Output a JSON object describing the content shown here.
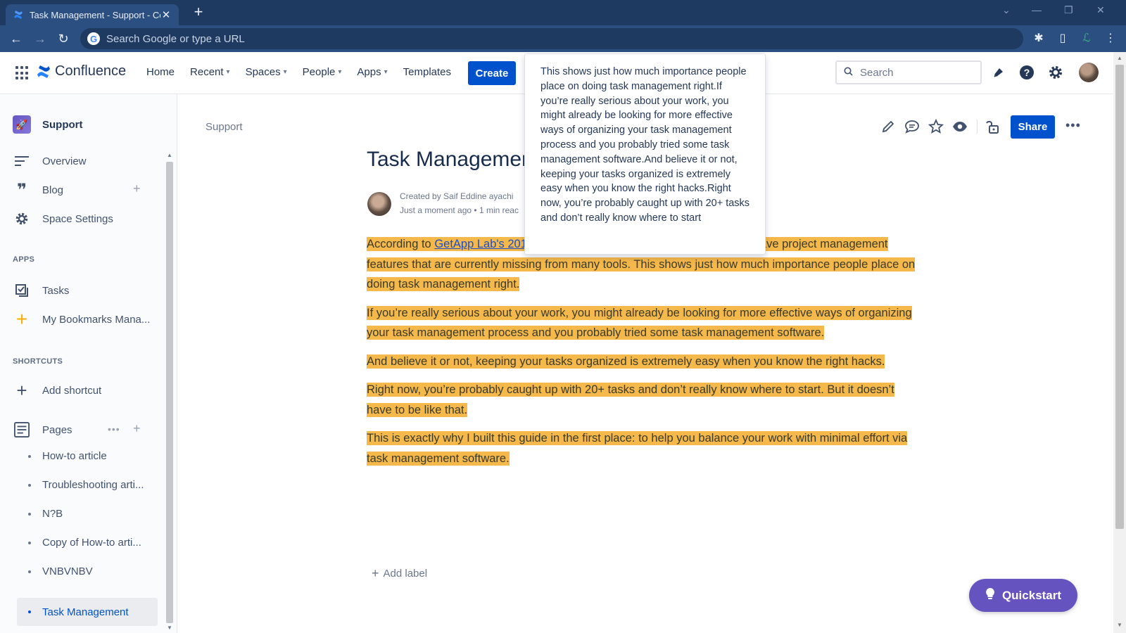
{
  "browser": {
    "tab_title": "Task Management - Support - Co",
    "address_placeholder": "Search Google or type a URL"
  },
  "header": {
    "brand": "Confluence",
    "nav": [
      {
        "label": "Home",
        "dropdown": false
      },
      {
        "label": "Recent",
        "dropdown": true
      },
      {
        "label": "Spaces",
        "dropdown": true
      },
      {
        "label": "People",
        "dropdown": true
      },
      {
        "label": "Apps",
        "dropdown": true
      },
      {
        "label": "Templates",
        "dropdown": false
      }
    ],
    "create_label": "Create",
    "search_placeholder": "Search"
  },
  "sidebar": {
    "space_name": "Support",
    "items": [
      {
        "label": "Overview",
        "icon": "overview-icon"
      },
      {
        "label": "Blog",
        "icon": "quote-icon"
      },
      {
        "label": "Space Settings",
        "icon": "gear-icon"
      }
    ],
    "apps_header": "APPS",
    "apps": [
      {
        "label": "Tasks",
        "icon": "tasks-icon"
      },
      {
        "label": "My Bookmarks Mana...",
        "icon": "plus-icon"
      }
    ],
    "shortcuts_header": "SHORTCUTS",
    "add_shortcut": "Add shortcut",
    "pages_label": "Pages",
    "pages": [
      {
        "label": "How-to article",
        "active": false
      },
      {
        "label": "Troubleshooting arti...",
        "active": false
      },
      {
        "label": "N?B",
        "active": false
      },
      {
        "label": "Copy of How-to arti...",
        "active": false
      },
      {
        "label": "VNBVNBV",
        "active": false
      },
      {
        "label": "Task Management",
        "active": true
      }
    ]
  },
  "page": {
    "breadcrumb": "Support",
    "share_label": "Share",
    "title": "Task Managemen",
    "created_by": "Created by Saif Eddine ayachi",
    "time": "Just a moment ago",
    "read_time": "1 min reac",
    "para1_before": "According to ",
    "para1_link": "GetApp Lab's 201",
    "para1_mid": "ave project management",
    "para1_rest": "features that are currently missing from many tools. This shows just how much importance people place on doing task management right.",
    "para2": "If you’re really serious about your work, you might already be looking for more effective ways of organizing your task management process and you probably tried some task management software.",
    "para3": "And believe it or not, keeping your tasks organized is extremely easy when you know the right hacks.",
    "para4": "Right now, you’re probably caught up with 20+ tasks and don’t really know where to start. But it doesn’t have to be like that.",
    "para5": "This is exactly why I built this guide in the first place: to help you balance your work with minimal effort via task management software.",
    "add_label": "Add label"
  },
  "popup": {
    "text": "This shows just how much importance people place on doing task management right.If you’re really serious about your work, you might already be looking for more effective ways of organizing your task management process and you probably tried some task management software.And believe it or not, keeping your tasks organized is extremely easy when you know the right hacks.Right now, you’re probably caught up with 20+ tasks and don’t really know where to start"
  },
  "quickstart_label": "Quickstart",
  "colors": {
    "brand_blue": "#0052CC",
    "highlight": "#F5B84A",
    "quickstart": "#6554C0",
    "chrome_dark": "#1f3a60"
  }
}
